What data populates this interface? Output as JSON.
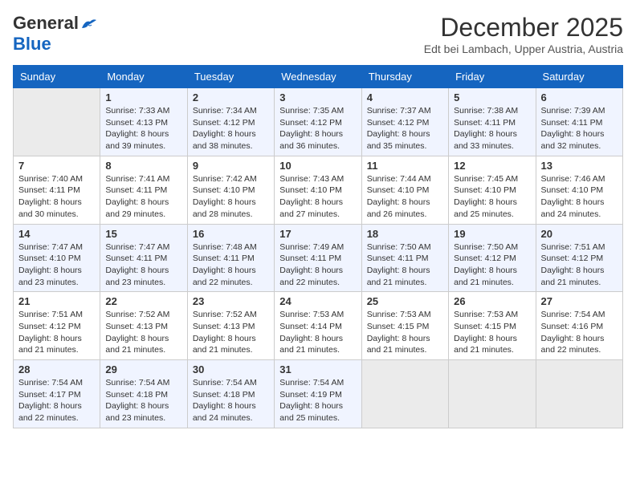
{
  "logo": {
    "general": "General",
    "blue": "Blue"
  },
  "header": {
    "month": "December 2025",
    "location": "Edt bei Lambach, Upper Austria, Austria"
  },
  "days_of_week": [
    "Sunday",
    "Monday",
    "Tuesday",
    "Wednesday",
    "Thursday",
    "Friday",
    "Saturday"
  ],
  "weeks": [
    [
      {
        "day": "",
        "sunrise": "",
        "sunset": "",
        "daylight": ""
      },
      {
        "day": "1",
        "sunrise": "Sunrise: 7:33 AM",
        "sunset": "Sunset: 4:13 PM",
        "daylight": "Daylight: 8 hours and 39 minutes."
      },
      {
        "day": "2",
        "sunrise": "Sunrise: 7:34 AM",
        "sunset": "Sunset: 4:12 PM",
        "daylight": "Daylight: 8 hours and 38 minutes."
      },
      {
        "day": "3",
        "sunrise": "Sunrise: 7:35 AM",
        "sunset": "Sunset: 4:12 PM",
        "daylight": "Daylight: 8 hours and 36 minutes."
      },
      {
        "day": "4",
        "sunrise": "Sunrise: 7:37 AM",
        "sunset": "Sunset: 4:12 PM",
        "daylight": "Daylight: 8 hours and 35 minutes."
      },
      {
        "day": "5",
        "sunrise": "Sunrise: 7:38 AM",
        "sunset": "Sunset: 4:11 PM",
        "daylight": "Daylight: 8 hours and 33 minutes."
      },
      {
        "day": "6",
        "sunrise": "Sunrise: 7:39 AM",
        "sunset": "Sunset: 4:11 PM",
        "daylight": "Daylight: 8 hours and 32 minutes."
      }
    ],
    [
      {
        "day": "7",
        "sunrise": "Sunrise: 7:40 AM",
        "sunset": "Sunset: 4:11 PM",
        "daylight": "Daylight: 8 hours and 30 minutes."
      },
      {
        "day": "8",
        "sunrise": "Sunrise: 7:41 AM",
        "sunset": "Sunset: 4:11 PM",
        "daylight": "Daylight: 8 hours and 29 minutes."
      },
      {
        "day": "9",
        "sunrise": "Sunrise: 7:42 AM",
        "sunset": "Sunset: 4:10 PM",
        "daylight": "Daylight: 8 hours and 28 minutes."
      },
      {
        "day": "10",
        "sunrise": "Sunrise: 7:43 AM",
        "sunset": "Sunset: 4:10 PM",
        "daylight": "Daylight: 8 hours and 27 minutes."
      },
      {
        "day": "11",
        "sunrise": "Sunrise: 7:44 AM",
        "sunset": "Sunset: 4:10 PM",
        "daylight": "Daylight: 8 hours and 26 minutes."
      },
      {
        "day": "12",
        "sunrise": "Sunrise: 7:45 AM",
        "sunset": "Sunset: 4:10 PM",
        "daylight": "Daylight: 8 hours and 25 minutes."
      },
      {
        "day": "13",
        "sunrise": "Sunrise: 7:46 AM",
        "sunset": "Sunset: 4:10 PM",
        "daylight": "Daylight: 8 hours and 24 minutes."
      }
    ],
    [
      {
        "day": "14",
        "sunrise": "Sunrise: 7:47 AM",
        "sunset": "Sunset: 4:10 PM",
        "daylight": "Daylight: 8 hours and 23 minutes."
      },
      {
        "day": "15",
        "sunrise": "Sunrise: 7:47 AM",
        "sunset": "Sunset: 4:11 PM",
        "daylight": "Daylight: 8 hours and 23 minutes."
      },
      {
        "day": "16",
        "sunrise": "Sunrise: 7:48 AM",
        "sunset": "Sunset: 4:11 PM",
        "daylight": "Daylight: 8 hours and 22 minutes."
      },
      {
        "day": "17",
        "sunrise": "Sunrise: 7:49 AM",
        "sunset": "Sunset: 4:11 PM",
        "daylight": "Daylight: 8 hours and 22 minutes."
      },
      {
        "day": "18",
        "sunrise": "Sunrise: 7:50 AM",
        "sunset": "Sunset: 4:11 PM",
        "daylight": "Daylight: 8 hours and 21 minutes."
      },
      {
        "day": "19",
        "sunrise": "Sunrise: 7:50 AM",
        "sunset": "Sunset: 4:12 PM",
        "daylight": "Daylight: 8 hours and 21 minutes."
      },
      {
        "day": "20",
        "sunrise": "Sunrise: 7:51 AM",
        "sunset": "Sunset: 4:12 PM",
        "daylight": "Daylight: 8 hours and 21 minutes."
      }
    ],
    [
      {
        "day": "21",
        "sunrise": "Sunrise: 7:51 AM",
        "sunset": "Sunset: 4:12 PM",
        "daylight": "Daylight: 8 hours and 21 minutes."
      },
      {
        "day": "22",
        "sunrise": "Sunrise: 7:52 AM",
        "sunset": "Sunset: 4:13 PM",
        "daylight": "Daylight: 8 hours and 21 minutes."
      },
      {
        "day": "23",
        "sunrise": "Sunrise: 7:52 AM",
        "sunset": "Sunset: 4:13 PM",
        "daylight": "Daylight: 8 hours and 21 minutes."
      },
      {
        "day": "24",
        "sunrise": "Sunrise: 7:53 AM",
        "sunset": "Sunset: 4:14 PM",
        "daylight": "Daylight: 8 hours and 21 minutes."
      },
      {
        "day": "25",
        "sunrise": "Sunrise: 7:53 AM",
        "sunset": "Sunset: 4:15 PM",
        "daylight": "Daylight: 8 hours and 21 minutes."
      },
      {
        "day": "26",
        "sunrise": "Sunrise: 7:53 AM",
        "sunset": "Sunset: 4:15 PM",
        "daylight": "Daylight: 8 hours and 21 minutes."
      },
      {
        "day": "27",
        "sunrise": "Sunrise: 7:54 AM",
        "sunset": "Sunset: 4:16 PM",
        "daylight": "Daylight: 8 hours and 22 minutes."
      }
    ],
    [
      {
        "day": "28",
        "sunrise": "Sunrise: 7:54 AM",
        "sunset": "Sunset: 4:17 PM",
        "daylight": "Daylight: 8 hours and 22 minutes."
      },
      {
        "day": "29",
        "sunrise": "Sunrise: 7:54 AM",
        "sunset": "Sunset: 4:18 PM",
        "daylight": "Daylight: 8 hours and 23 minutes."
      },
      {
        "day": "30",
        "sunrise": "Sunrise: 7:54 AM",
        "sunset": "Sunset: 4:18 PM",
        "daylight": "Daylight: 8 hours and 24 minutes."
      },
      {
        "day": "31",
        "sunrise": "Sunrise: 7:54 AM",
        "sunset": "Sunset: 4:19 PM",
        "daylight": "Daylight: 8 hours and 25 minutes."
      },
      {
        "day": "",
        "sunrise": "",
        "sunset": "",
        "daylight": ""
      },
      {
        "day": "",
        "sunrise": "",
        "sunset": "",
        "daylight": ""
      },
      {
        "day": "",
        "sunrise": "",
        "sunset": "",
        "daylight": ""
      }
    ]
  ]
}
